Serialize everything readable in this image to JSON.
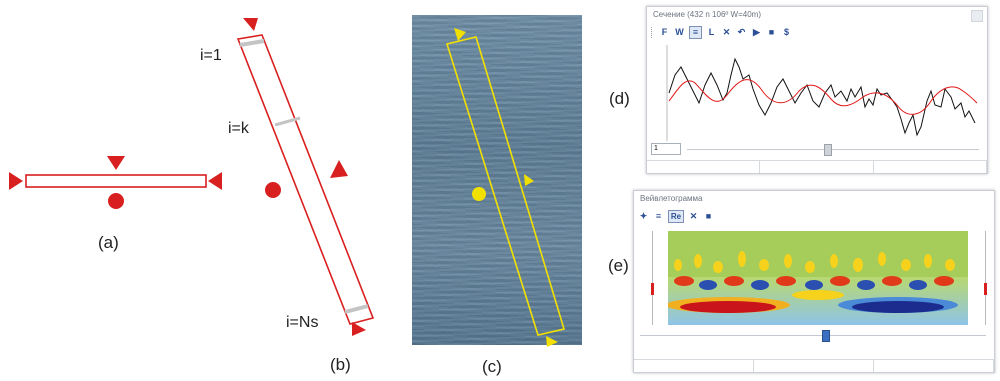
{
  "panels": {
    "a": {
      "label": "(a)"
    },
    "b": {
      "label": "(b)",
      "index_top": "i=1",
      "index_mid": "i=k",
      "index_bottom": "i=Ns"
    },
    "c": {
      "label": "(c)"
    },
    "d": {
      "label": "(d)",
      "window_title": "Сечение (432 n 106º W=40m)",
      "spin_value": "1",
      "toolbar": [
        "F",
        "W",
        "≡",
        "L",
        "✕",
        "↶",
        "▶",
        "■",
        "$"
      ]
    },
    "e": {
      "label": "(e)",
      "window_title": "Вейвлетограмма",
      "toolbar": [
        "✦",
        "≡",
        "Re",
        "✕",
        "■"
      ]
    }
  },
  "colors": {
    "outline_red": "#d92020",
    "marker_yellow": "#f2e000",
    "curve_red": "#e01818",
    "curve_black": "#111111"
  }
}
